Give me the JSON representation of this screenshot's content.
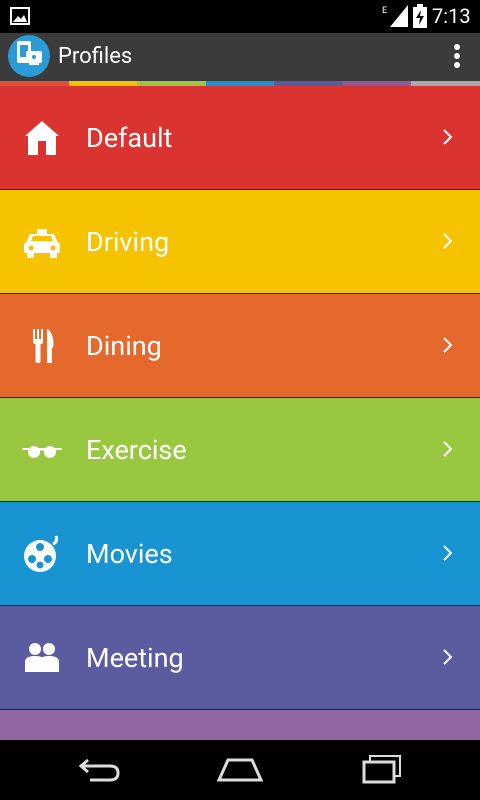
{
  "status": {
    "time": "7:13",
    "network": "E"
  },
  "action_bar": {
    "title": "Profiles"
  },
  "colors": {
    "strip": [
      "#e24f3a",
      "#f5c400",
      "#9dc53f",
      "#1a93d2",
      "#5c5b9e",
      "#8e5a9a",
      "#a8a8a8"
    ],
    "default": "#db3430",
    "driving": "#f5c300",
    "dining": "#e5692c",
    "exercise": "#99c73f",
    "movies": "#1994d2",
    "meeting": "#5b5b9f",
    "partial": "#9267a4"
  },
  "profiles": [
    {
      "label": "Default",
      "icon": "home-icon"
    },
    {
      "label": "Driving",
      "icon": "car-icon"
    },
    {
      "label": "Dining",
      "icon": "fork-knife-icon"
    },
    {
      "label": "Exercise",
      "icon": "sunglasses-icon"
    },
    {
      "label": "Movies",
      "icon": "film-reel-icon"
    },
    {
      "label": "Meeting",
      "icon": "people-icon"
    }
  ]
}
